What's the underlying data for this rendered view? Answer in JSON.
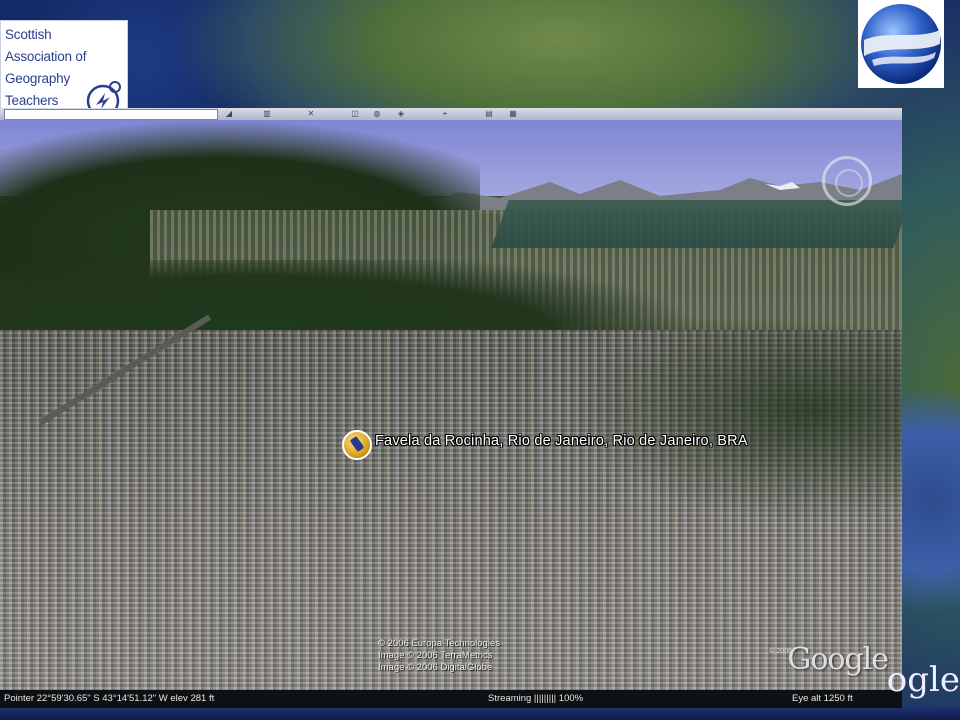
{
  "slide": {
    "logo_saogt": {
      "line1": "Scottish",
      "line2": "Association of",
      "line3": "Geography",
      "line4": "Teachers"
    },
    "logo_ge_icon": "google-earth-logo-icon",
    "google_watermark_outside": "ogle"
  },
  "viewer": {
    "placemark_label": "Favela da Rocinha, Rio de Janeiro, Rio de Janeiro, BRA",
    "placemark_icon": "pushpin-icon",
    "credits": [
      "© 2006 Europa Technologies",
      "Image © 2006 TerraMetrics",
      "Image © 2006 DigitalGlobe"
    ],
    "google_logo": "Google",
    "google_copyright": "© 2006"
  },
  "statusbar": {
    "pointer": "Pointer 22°59'30.65\" S   43°14'51.12\" W   elev  281 ft",
    "streaming": "Streaming ||||||||| 100%",
    "eye_alt": "Eye alt     1250 ft"
  }
}
